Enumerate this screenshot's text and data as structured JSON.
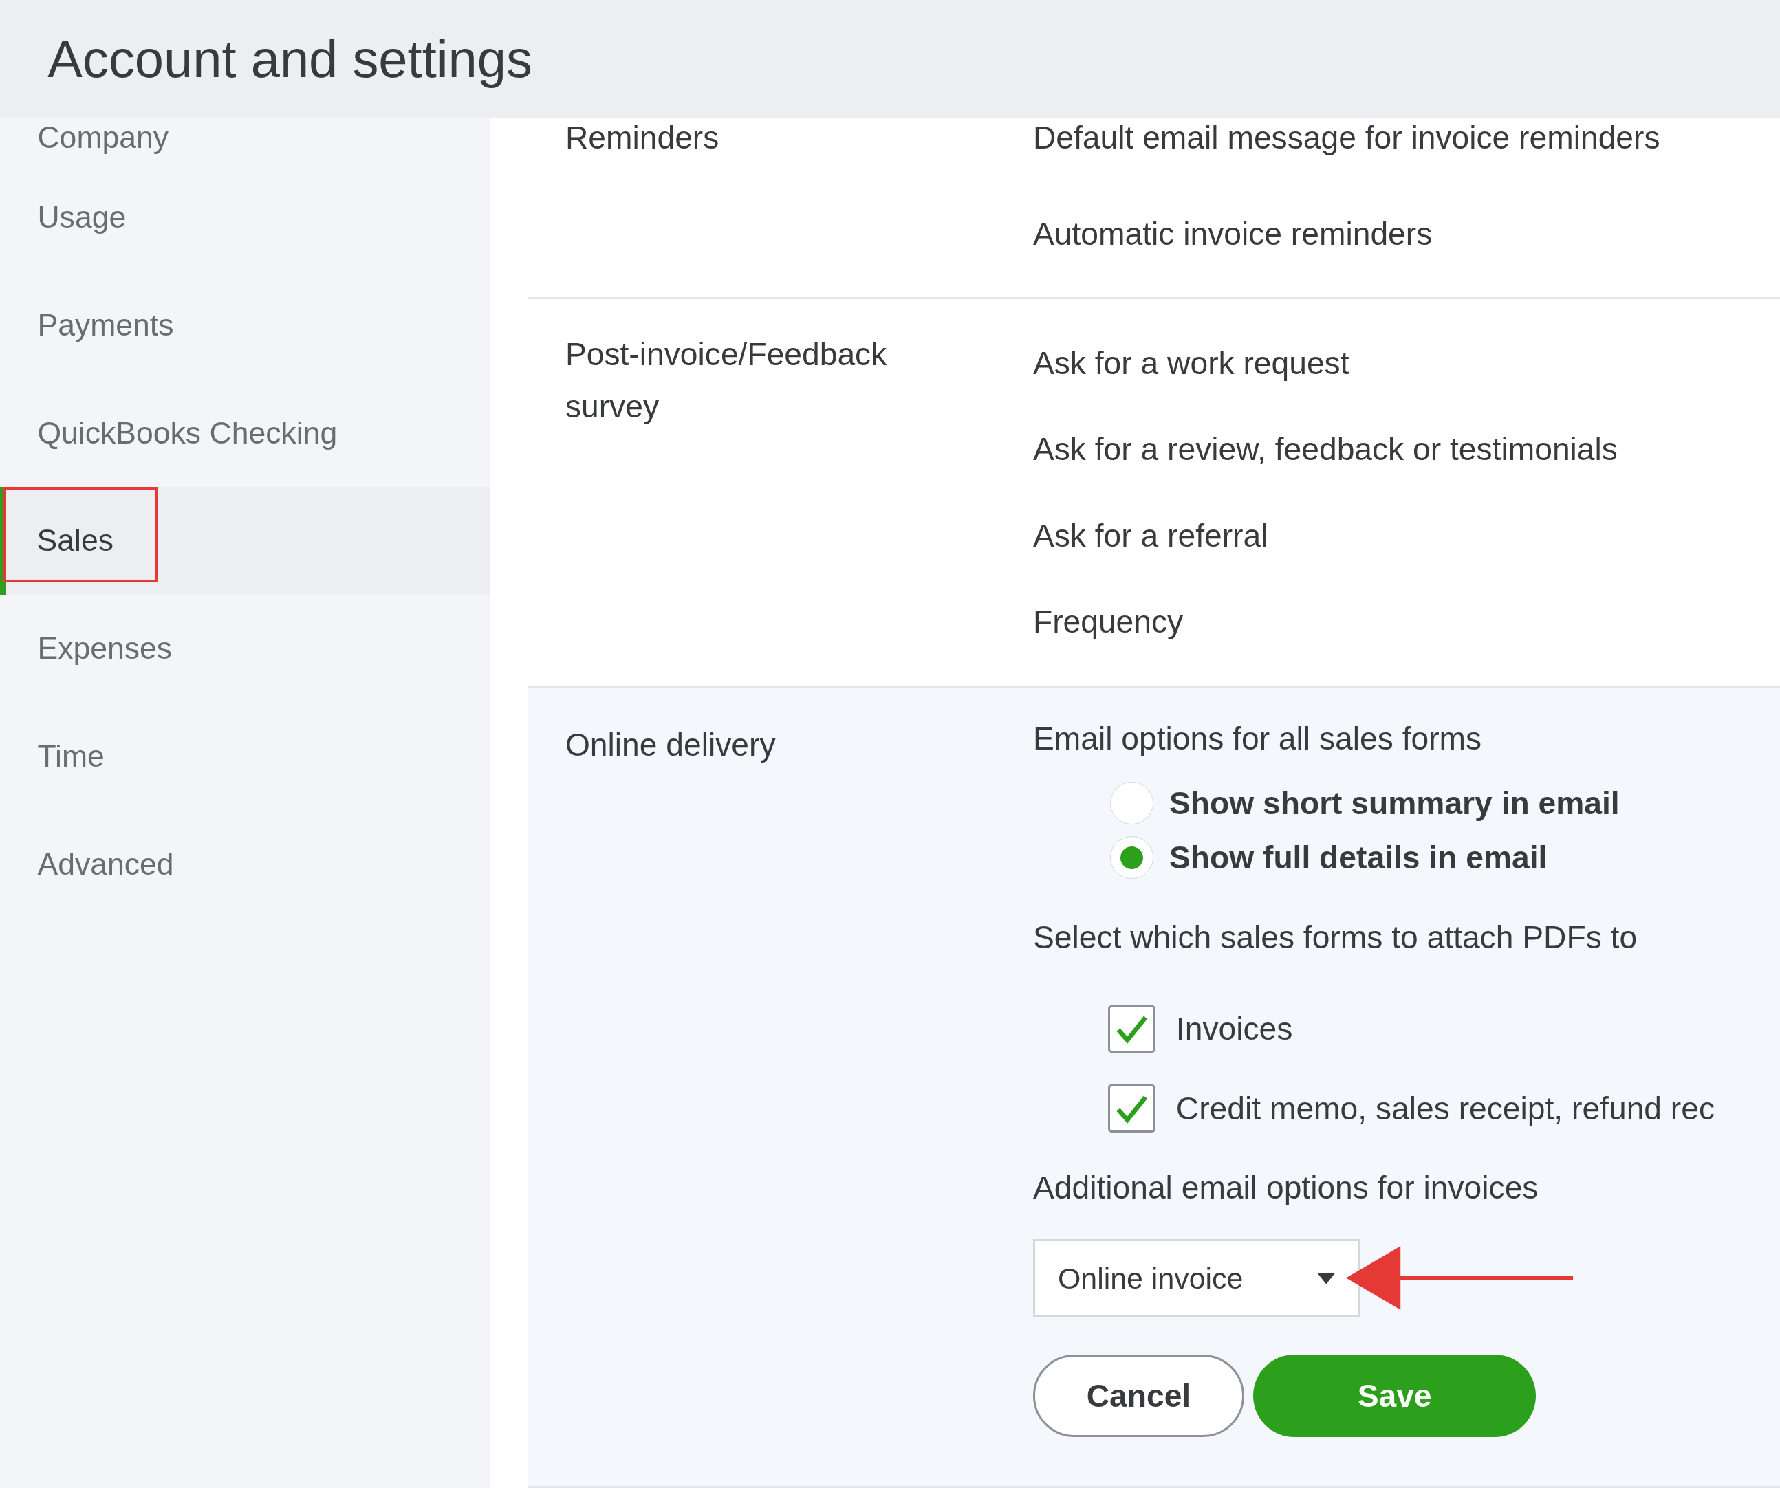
{
  "header": {
    "title": "Account and settings"
  },
  "sidebar": {
    "items": [
      {
        "label": "Company",
        "selected": false
      },
      {
        "label": "Usage",
        "selected": false
      },
      {
        "label": "Payments",
        "selected": false
      },
      {
        "label": "QuickBooks Checking",
        "selected": false
      },
      {
        "label": "Sales",
        "selected": true
      },
      {
        "label": "Expenses",
        "selected": false
      },
      {
        "label": "Time",
        "selected": false
      },
      {
        "label": "Advanced",
        "selected": false
      }
    ]
  },
  "sections": [
    {
      "title": "Reminders",
      "rows": [
        "Default email message for invoice reminders",
        "Automatic invoice reminders"
      ]
    },
    {
      "title": "Post-invoice/Feedback survey",
      "rows": [
        "Ask for a work request",
        "Ask for a review, feedback or testimonials",
        "Ask for a referral",
        "Frequency"
      ]
    }
  ],
  "online_delivery": {
    "title": "Online delivery",
    "email_options_label": "Email options for all sales forms",
    "radios": [
      {
        "label": "Show short summary in email",
        "selected": false
      },
      {
        "label": "Show full details in email",
        "selected": true
      }
    ],
    "attach_label": "Select which sales forms to attach PDFs to",
    "checkboxes": [
      {
        "label": "Invoices",
        "checked": true
      },
      {
        "label": "Credit memo, sales receipt, refund rec",
        "checked": true
      }
    ],
    "additional_label": "Additional email options for invoices",
    "dropdown": {
      "value": "Online invoice"
    },
    "buttons": {
      "cancel": "Cancel",
      "save": "Save"
    }
  }
}
